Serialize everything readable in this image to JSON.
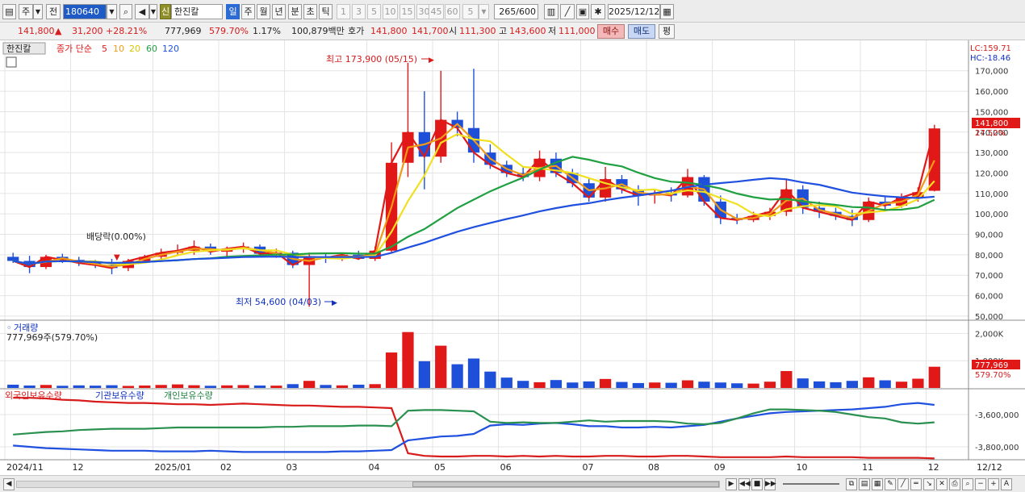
{
  "toolbar": {
    "period_label": "주",
    "prev_label": "전",
    "code": "180640",
    "badge": "신",
    "stock_name": "한진칼",
    "tabs": [
      "일",
      "주",
      "월",
      "년",
      "분",
      "초",
      "틱"
    ],
    "numbers": [
      "1",
      "3",
      "5",
      "10",
      "15",
      "30",
      "45",
      "60"
    ],
    "count_value": "5",
    "range_value": "265",
    "range_total": "/600",
    "date_value": "2025/12/12"
  },
  "quote": {
    "price": "141,800",
    "change_arrow": "▲",
    "change": "31,200",
    "change_pct": "+28.21%",
    "volume": "777,969",
    "volume_ratio": "579.70%",
    "turnover": "1.17%",
    "amount": "100,879백만",
    "bid_label": "호가",
    "bid": "141,800",
    "ask": "141,700",
    "open_label": "시",
    "open": "111,300",
    "high_label": "고",
    "high": "143,600",
    "low_label": "저",
    "low": "111,000",
    "buy_label": "매수",
    "sell_label": "매도",
    "eval_label": "평"
  },
  "chart_data": {
    "type": "candlestick",
    "stock_tag": "한진칼",
    "ma_legend": {
      "prefix": "종가 단순",
      "periods": [
        "5",
        "10",
        "20",
        "60",
        "120"
      ],
      "colors": [
        "#e01818",
        "#f09a18",
        "#f0e020",
        "#20a040",
        "#2050e0"
      ]
    },
    "lc_label": "LC:159.71",
    "hc_label": "HC:-18.46",
    "price_axis": {
      "ticks": [
        "170,000",
        "160,000",
        "150,000",
        "140,000",
        "130,000",
        "120,000",
        "110,000",
        "100,000",
        "90,000",
        "80,000",
        "70,000",
        "60,000",
        "50,000"
      ],
      "min": 48000,
      "max": 177000
    },
    "last_price_label": "141,800",
    "last_pct_label": "27.52%",
    "annotations": {
      "high": "최고 173,900 (05/15)",
      "low": "최저 54,600 (04/03)",
      "dividend": "배당락(0.00%)"
    },
    "weekly_ohlc": [
      [
        79000,
        81000,
        76000,
        77000
      ],
      [
        77000,
        79500,
        71000,
        74000
      ],
      [
        74000,
        80000,
        73000,
        79000
      ],
      [
        79000,
        80500,
        76000,
        77500
      ],
      [
        77500,
        79000,
        74500,
        76000
      ],
      [
        76000,
        77500,
        73500,
        75000
      ],
      [
        75000,
        78000,
        70500,
        73500
      ],
      [
        73500,
        78000,
        72000,
        77000
      ],
      [
        77000,
        80000,
        76000,
        79000
      ],
      [
        79000,
        83000,
        78000,
        81000
      ],
      [
        81000,
        85000,
        79500,
        82000
      ],
      [
        82000,
        87000,
        80000,
        84000
      ],
      [
        84000,
        85500,
        80000,
        81500
      ],
      [
        81500,
        84000,
        79000,
        83000
      ],
      [
        83000,
        86000,
        81000,
        84000
      ],
      [
        84000,
        85000,
        79000,
        80500
      ],
      [
        80500,
        83000,
        78500,
        81000
      ],
      [
        81000,
        82000,
        73500,
        75000
      ],
      [
        75000,
        81000,
        54600,
        79000
      ],
      [
        79000,
        81000,
        76000,
        78500
      ],
      [
        78500,
        81000,
        77000,
        80000
      ],
      [
        80000,
        82000,
        77500,
        78000
      ],
      [
        78000,
        84000,
        77000,
        82000
      ],
      [
        82000,
        135000,
        81000,
        125000
      ],
      [
        125000,
        173900,
        118000,
        140000
      ],
      [
        140000,
        160000,
        112000,
        128000
      ],
      [
        128000,
        170000,
        125000,
        146000
      ],
      [
        146000,
        150000,
        138000,
        142000
      ],
      [
        142000,
        171000,
        125000,
        130000
      ],
      [
        130000,
        134000,
        122000,
        124000
      ],
      [
        124000,
        126000,
        118000,
        120000
      ],
      [
        120000,
        123000,
        116000,
        118000
      ],
      [
        118000,
        131000,
        116000,
        127000
      ],
      [
        127000,
        130000,
        118000,
        120000
      ],
      [
        120000,
        122000,
        113000,
        115000
      ],
      [
        115000,
        117000,
        106000,
        108000
      ],
      [
        108000,
        123000,
        106000,
        117000
      ],
      [
        117000,
        119000,
        110000,
        112000
      ],
      [
        112000,
        114000,
        104000,
        109000
      ],
      [
        109000,
        112000,
        105000,
        110000
      ],
      [
        110000,
        113000,
        106000,
        109000
      ],
      [
        109000,
        122000,
        108000,
        118000
      ],
      [
        118000,
        119000,
        104000,
        106000
      ],
      [
        106000,
        109000,
        95000,
        98000
      ],
      [
        98000,
        100000,
        95000,
        97000
      ],
      [
        97000,
        101000,
        96000,
        99000
      ],
      [
        99000,
        103000,
        97000,
        101000
      ],
      [
        101000,
        117000,
        99000,
        112000
      ],
      [
        112000,
        114000,
        100000,
        103000
      ],
      [
        103000,
        106000,
        98000,
        101000
      ],
      [
        101000,
        103000,
        97000,
        99000
      ],
      [
        99000,
        102000,
        94000,
        97000
      ],
      [
        97000,
        108000,
        96000,
        106000
      ],
      [
        106000,
        109000,
        102000,
        104000
      ],
      [
        104000,
        110000,
        103000,
        108000
      ],
      [
        108000,
        113000,
        106000,
        110600
      ],
      [
        111300,
        143600,
        111000,
        141800
      ]
    ],
    "volume_axis": {
      "ticks": [
        "2,000K",
        "1,000K"
      ],
      "max": 2100
    },
    "volume_label": "거래량",
    "volume_value_label": "777,969주(579.70%)",
    "volume_tag": "777,969",
    "volume_pct_tag": "579.70%",
    "weekly_volume_k": [
      120,
      90,
      110,
      80,
      95,
      85,
      100,
      75,
      90,
      110,
      130,
      100,
      80,
      95,
      105,
      90,
      85,
      140,
      260,
      110,
      95,
      120,
      140,
      1300,
      2050,
      980,
      1550,
      870,
      1080,
      600,
      380,
      260,
      210,
      290,
      200,
      240,
      330,
      220,
      180,
      200,
      190,
      280,
      230,
      200,
      170,
      160,
      230,
      620,
      350,
      240,
      210,
      260,
      390,
      280,
      230,
      340,
      778
    ],
    "ownership_legend": [
      "외국인보유수량",
      "기관보유수량",
      "개인보유수량"
    ],
    "ownership_axis": {
      "ticks": [
        "-3,600,000",
        "-3,800,000"
      ]
    },
    "ownership_series": {
      "foreign": [
        96,
        96,
        95,
        93,
        92,
        90,
        89,
        88,
        88,
        87,
        86,
        86,
        85,
        86,
        87,
        86,
        85,
        84,
        84,
        83,
        82,
        82,
        81,
        80,
        10,
        6,
        5,
        5,
        6,
        6,
        5,
        6,
        5,
        6,
        5,
        5,
        6,
        6,
        5,
        5,
        6,
        6,
        5,
        4,
        4,
        4,
        4,
        5,
        4,
        4,
        4,
        4,
        3,
        3,
        3,
        3,
        2
      ],
      "institution": [
        22,
        20,
        18,
        17,
        16,
        15,
        14,
        14,
        14,
        13,
        13,
        13,
        14,
        13,
        12,
        12,
        12,
        12,
        12,
        12,
        13,
        13,
        14,
        15,
        30,
        33,
        36,
        37,
        40,
        53,
        55,
        54,
        56,
        57,
        55,
        52,
        52,
        50,
        50,
        51,
        50,
        52,
        54,
        59,
        64,
        68,
        72,
        74,
        75,
        76,
        77,
        78,
        80,
        82,
        86,
        88,
        85
      ],
      "individual": [
        39,
        41,
        43,
        44,
        46,
        47,
        48,
        48,
        48,
        49,
        50,
        50,
        50,
        50,
        50,
        50,
        51,
        51,
        52,
        52,
        52,
        53,
        53,
        52,
        76,
        77,
        77,
        76,
        75,
        59,
        57,
        58,
        57,
        57,
        59,
        61,
        59,
        60,
        60,
        60,
        59,
        56,
        55,
        57,
        64,
        72,
        78,
        78,
        77,
        76,
        74,
        70,
        66,
        64,
        58,
        56,
        58
      ]
    },
    "x_labels": [
      "2024/11",
      "12",
      "2025/01",
      "02",
      "03",
      "04",
      "05",
      "06",
      "07",
      "08",
      "09",
      "10",
      "11",
      "12"
    ],
    "x_right_label": "12/12"
  }
}
